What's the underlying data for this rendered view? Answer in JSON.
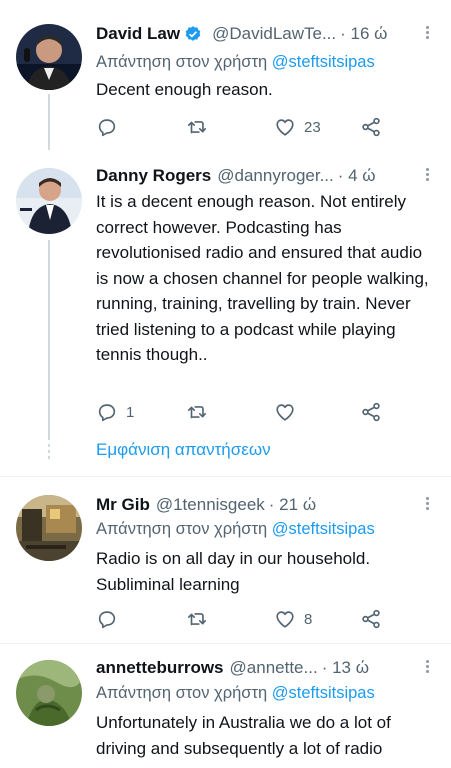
{
  "tweets": [
    {
      "name": "David Law",
      "verified": true,
      "handle": "@DavidLawTe...",
      "time": "· 16 ώ",
      "reply_prefix": "Απάντηση στον χρήστη",
      "reply_mention": "@steftsitsipas",
      "text": "Decent enough reason.",
      "replies": "",
      "retweets": "",
      "likes": "23"
    },
    {
      "name": "Danny Rogers",
      "verified": false,
      "handle": "@dannyroger...",
      "time": "· 4 ώ",
      "text": "It is a decent enough reason. Not entirely correct however. Podcasting has revolutionised radio and ensured that audio is now a chosen channel for people walking, running, training, travelling by train. Never tried listening to a podcast while playing tennis though..",
      "replies": "1",
      "retweets": "",
      "likes": ""
    },
    {
      "name": "Mr Gib",
      "verified": false,
      "handle": "@1tennisgeek",
      "time": "· 21 ώ",
      "reply_prefix": "Απάντηση στον χρήστη",
      "reply_mention": "@steftsitsipas",
      "text": "Radio is on all day in our household. Subliminal learning",
      "replies": "",
      "retweets": "",
      "likes": "8"
    },
    {
      "name": "annetteburrows",
      "verified": false,
      "handle": "@annette...",
      "time": "· 13 ώ",
      "reply_prefix": "Απάντηση στον χρήστη",
      "reply_mention": "@steftsitsipas",
      "text": "Unfortunately in Australia we do a lot of driving and subsequently a lot of radio"
    }
  ],
  "show_replies_label": "Εμφάνιση απαντήσεων",
  "colors": {
    "accent": "#1d9bf0",
    "secondary_text": "#536471",
    "primary_text": "#0f1419",
    "divider": "#eff3f4"
  },
  "icons": {
    "reply": "reply-icon",
    "retweet": "retweet-icon",
    "like": "heart-icon",
    "share": "share-icon",
    "more": "more-vertical-icon",
    "verified": "verified-badge-icon"
  }
}
